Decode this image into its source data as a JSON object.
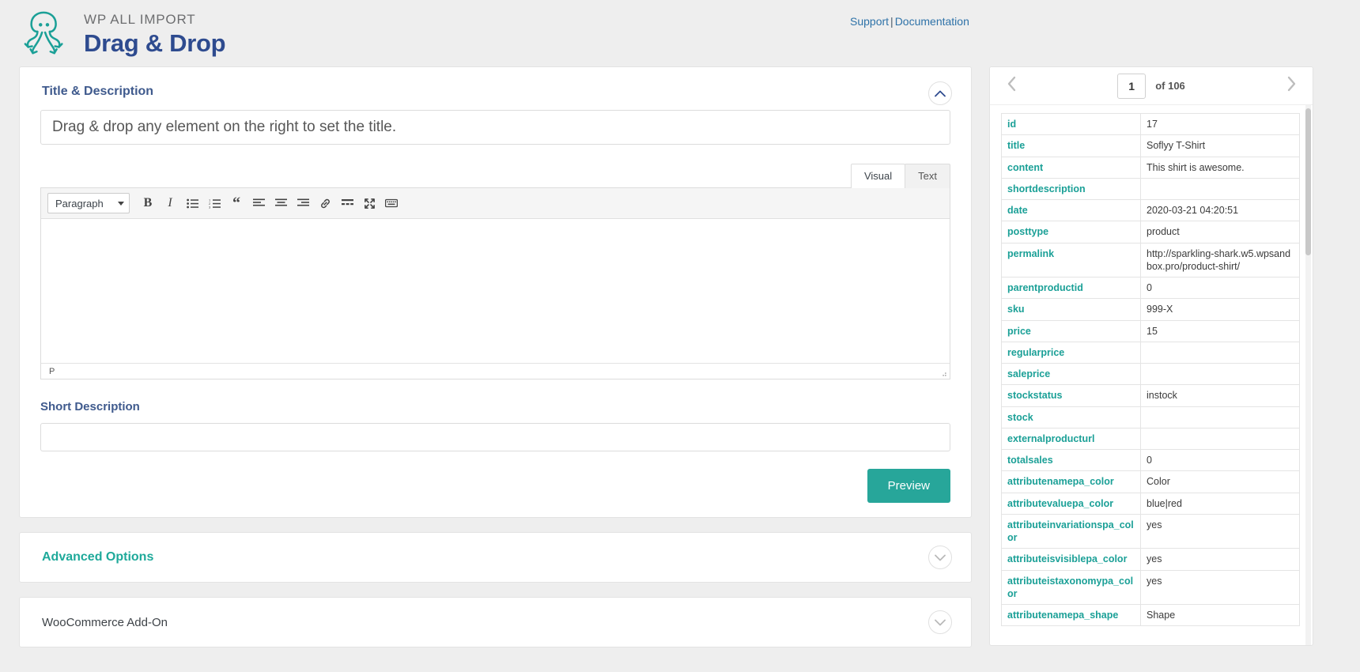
{
  "header": {
    "brand_top": "WP ALL IMPORT",
    "brand_bottom": "Drag & Drop",
    "support_link": "Support",
    "separator": "|",
    "documentation_link": "Documentation",
    "logo_icon": "octopus-logo-icon",
    "accent_teal": "#1ba097",
    "brand_blue": "#2e4b8f"
  },
  "title_panel": {
    "heading": "Title & Description",
    "collapse_icon": "chevron-up-icon",
    "title_placeholder": "Drag & drop any element on the right to set the title.",
    "title_value": "",
    "editor": {
      "tabs": [
        {
          "label": "Visual",
          "active": true
        },
        {
          "label": "Text",
          "active": false
        }
      ],
      "format_select": "Paragraph",
      "format_caret_icon": "chevron-down-icon",
      "toolbar": [
        {
          "name": "bold-icon",
          "glyph": "B"
        },
        {
          "name": "italic-icon",
          "glyph": "I"
        },
        {
          "name": "bulleted-list-icon",
          "glyph": ""
        },
        {
          "name": "numbered-list-icon",
          "glyph": ""
        },
        {
          "name": "blockquote-icon",
          "glyph": "“"
        },
        {
          "name": "align-left-icon",
          "glyph": ""
        },
        {
          "name": "align-center-icon",
          "glyph": ""
        },
        {
          "name": "align-right-icon",
          "glyph": ""
        },
        {
          "name": "insert-link-icon",
          "glyph": ""
        },
        {
          "name": "read-more-icon",
          "glyph": ""
        },
        {
          "name": "fullscreen-icon",
          "glyph": ""
        },
        {
          "name": "toolbar-toggle-icon",
          "glyph": ""
        }
      ],
      "content": "",
      "status_path": "P",
      "resize_handle_icon": "resize-grip-icon"
    },
    "short_description_label": "Short Description",
    "short_description_value": "",
    "preview_button": "Preview"
  },
  "advanced_options": {
    "heading": "Advanced Options",
    "expand_icon": "chevron-down-icon"
  },
  "woocommerce_addon": {
    "heading": "WooCommerce Add-On",
    "expand_icon": "chevron-down-icon"
  },
  "preview_panel": {
    "prev_icon": "chevron-left-icon",
    "next_icon": "chevron-right-icon",
    "page_value": "1",
    "page_total": "of 106",
    "rows": [
      {
        "key": "id",
        "value": "17"
      },
      {
        "key": "title",
        "value": "Soflyy T-Shirt"
      },
      {
        "key": "content",
        "value": "This shirt is awesome."
      },
      {
        "key": "shortdescription",
        "value": ""
      },
      {
        "key": "date",
        "value": "2020-03-21 04:20:51"
      },
      {
        "key": "posttype",
        "value": "product"
      },
      {
        "key": "permalink",
        "value": "http://sparkling-shark.w5.wpsandbox.pro/product-shirt/"
      },
      {
        "key": "parentproductid",
        "value": "0"
      },
      {
        "key": "sku",
        "value": "999-X"
      },
      {
        "key": "price",
        "value": "15"
      },
      {
        "key": "regularprice",
        "value": ""
      },
      {
        "key": "saleprice",
        "value": ""
      },
      {
        "key": "stockstatus",
        "value": "instock"
      },
      {
        "key": "stock",
        "value": ""
      },
      {
        "key": "externalproducturl",
        "value": ""
      },
      {
        "key": "totalsales",
        "value": "0"
      },
      {
        "key": "attributenamepa_color",
        "value": "Color"
      },
      {
        "key": "attributevaluepa_color",
        "value": "blue|red"
      },
      {
        "key": "attributeinvariationspa_color",
        "value": "yes"
      },
      {
        "key": "attributeisvisiblepa_color",
        "value": "yes"
      },
      {
        "key": "attributeistaxonomypa_color",
        "value": "yes"
      },
      {
        "key": "attributenamepa_shape",
        "value": "Shape"
      }
    ]
  }
}
